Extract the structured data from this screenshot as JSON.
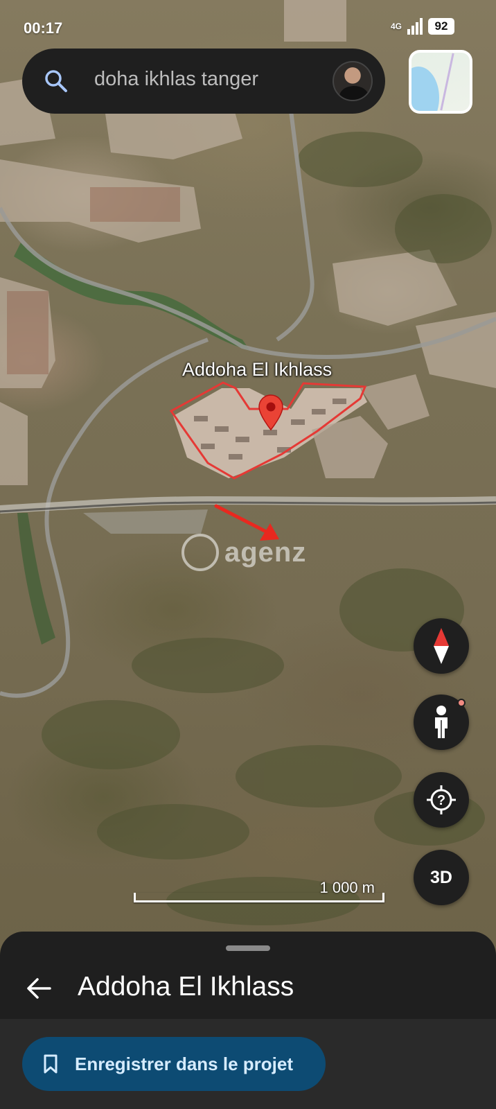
{
  "status_bar": {
    "time": "00:17",
    "network": "4G",
    "battery": "92"
  },
  "search": {
    "query": "doha ikhlas tanger"
  },
  "map": {
    "place_label": "Addoha El Ikhlass",
    "watermark": "agenz",
    "scale": "1 000 m",
    "view_mode_label": "3D"
  },
  "sheet": {
    "title": "Addoha El Ikhlass",
    "save_label": "Enregistrer dans le projet"
  },
  "icons": {
    "search": "search-icon",
    "compass": "compass-icon",
    "street_view": "pegman-icon",
    "locate": "my-location-icon",
    "back": "arrow-left-icon",
    "bookmark": "bookmark-icon",
    "pin": "map-pin-icon"
  },
  "colors": {
    "pin": "#ea4335",
    "boundary": "#e53935",
    "save_button_bg": "#0d4b73",
    "panel_bg": "#1f1f1f"
  }
}
